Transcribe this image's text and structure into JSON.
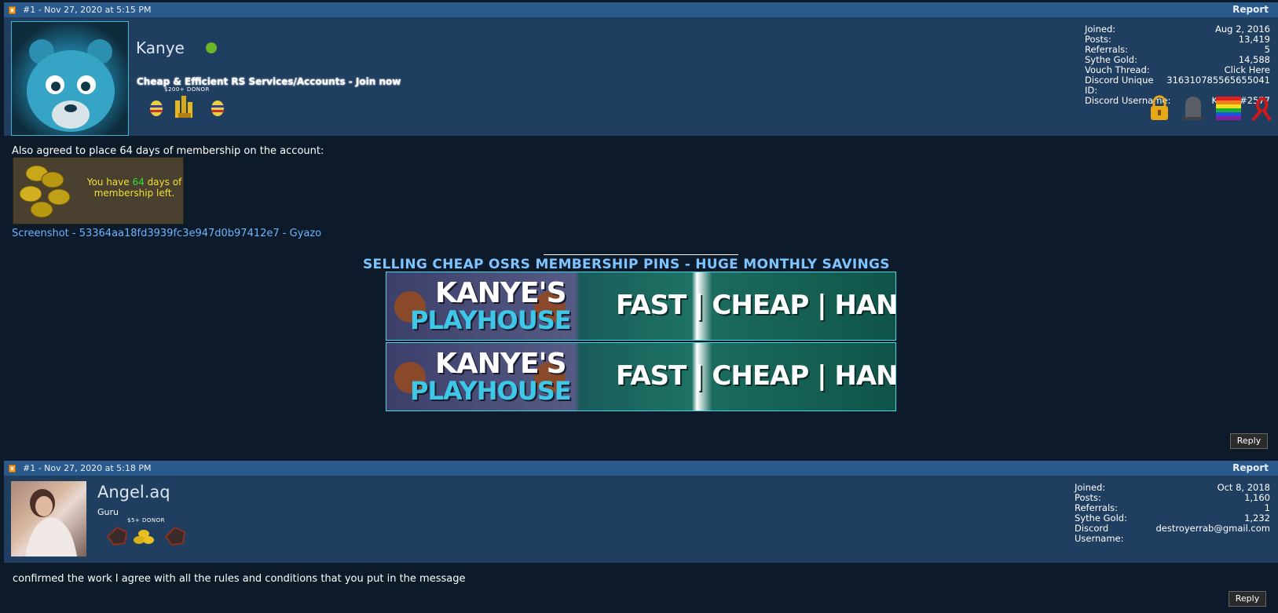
{
  "posts": [
    {
      "header": "#1 - Nov 27, 2020 at 5:15 PM",
      "report": "Report",
      "username": "Kanye",
      "usertitle": "Cheap & Efficient RS Services/Accounts - Join now",
      "donor_label": "$200+ DONOR",
      "stats": [
        {
          "label": "Joined:",
          "value": "Aug 2, 2016"
        },
        {
          "label": "Posts:",
          "value": "13,419"
        },
        {
          "label": "Referrals:",
          "value": "5"
        },
        {
          "label": "Sythe Gold:",
          "value": "14,588"
        },
        {
          "label": "Vouch Thread:",
          "value": "Click Here"
        },
        {
          "label": "Discord Unique ID:",
          "value": "316310785565655041"
        },
        {
          "label": "Discord Username:",
          "value": "Kanye#2577"
        }
      ],
      "message": "Also agreed to place 64 days of membership on the account:",
      "membership_text_1": "You have ",
      "membership_days": "64",
      "membership_text_2": " days of",
      "membership_text_3": "membership left.",
      "screenshot_link": "Screenshot - 53364aa18fd3939fc3e947d0b97412e7 - Gyazo",
      "signature_title": "SELLING CHEAP OSRS MEMBERSHIP PINS - HUGE MONTHLY SAVINGS",
      "banner": {
        "line1": "KANYE'S",
        "line2": "PLAYHOUSE",
        "tagline": "FAST | CHEAP | HANDMADE"
      },
      "reply": "Reply"
    },
    {
      "header": "#1 - Nov 27, 2020 at 5:18 PM",
      "report": "Report",
      "username": "Angel.aq",
      "usertitle": "Guru",
      "donor_label": "$5+ DONOR",
      "stats": [
        {
          "label": "Joined:",
          "value": "Oct 8, 2018"
        },
        {
          "label": "Posts:",
          "value": "1,160"
        },
        {
          "label": "Referrals:",
          "value": "1"
        },
        {
          "label": "Sythe Gold:",
          "value": "1,232"
        },
        {
          "label": "Discord Username:",
          "value": "destroyerrab@gmail.com"
        }
      ],
      "message": "confirmed the work I agree with all the rules and conditions that you put in the message",
      "reply": "Reply"
    }
  ],
  "colors": {
    "header_bg": "#2a5a8c",
    "profile_bg": "#203f60",
    "page_bg": "#0c1a2a",
    "link": "#6fb3ff",
    "online": "#6ab52a"
  }
}
